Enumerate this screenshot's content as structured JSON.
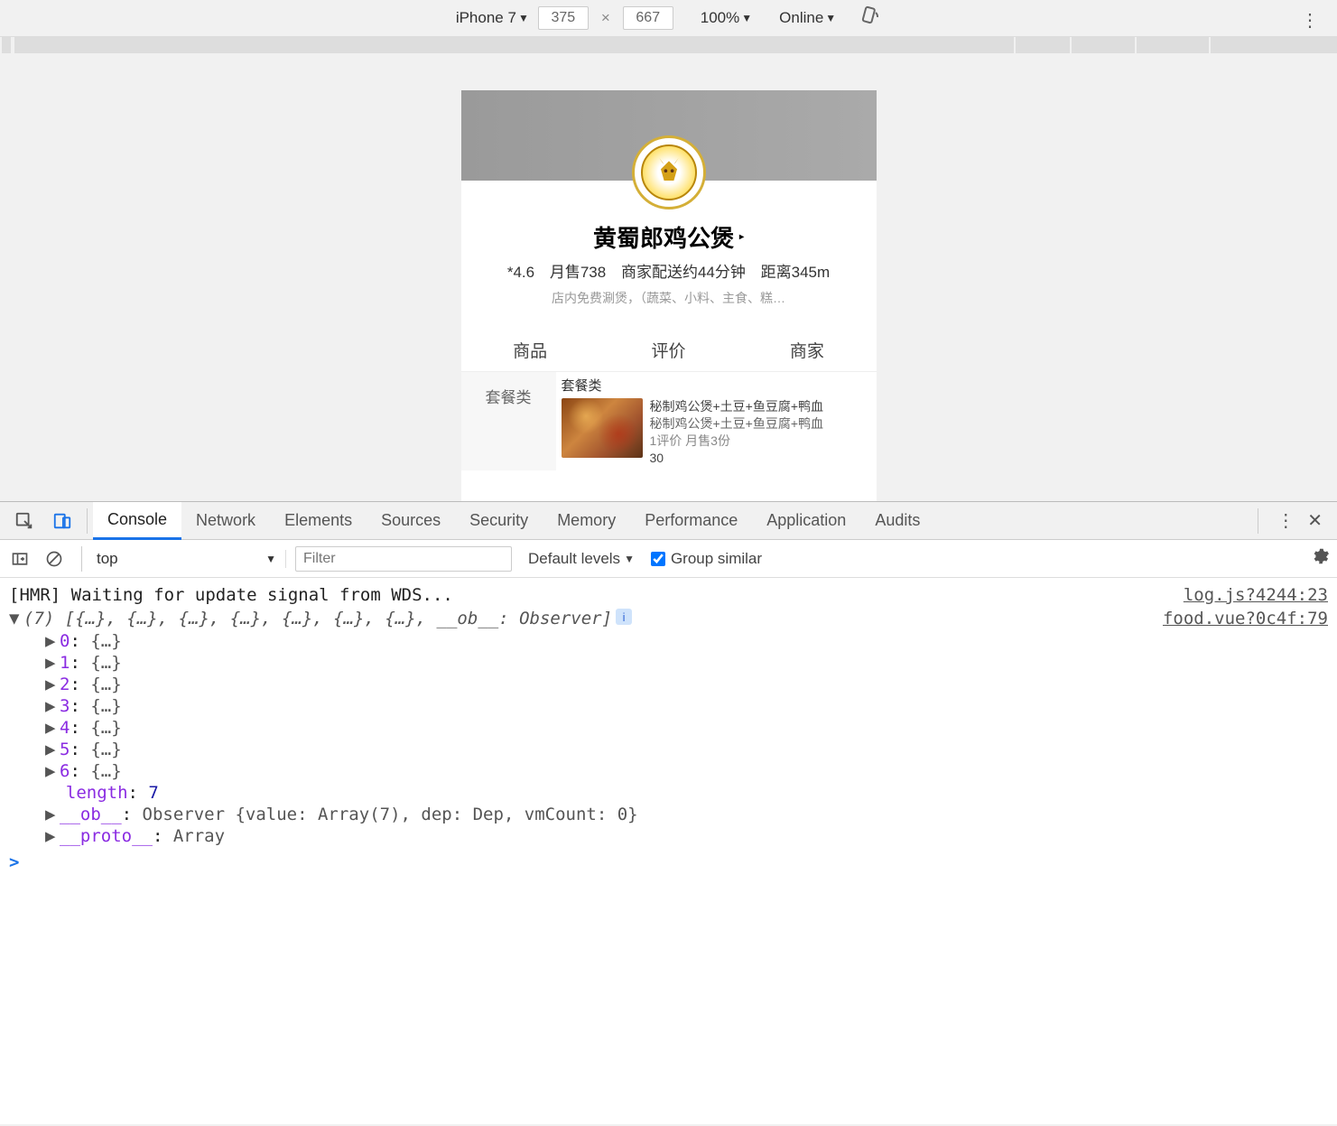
{
  "deviceToolbar": {
    "device": "iPhone 7",
    "width": "375",
    "height": "667",
    "zoom": "100%",
    "throttle": "Online"
  },
  "shop": {
    "title": "黄蜀郎鸡公煲",
    "rating": "*4.6",
    "monthlySales": "月售738",
    "delivery": "商家配送约44分钟",
    "distance": "距离345m",
    "desc": "店内免费涮煲，（蔬菜、小料、主食、糕…"
  },
  "tabs": {
    "goods": "商品",
    "reviews": "评价",
    "merchant": "商家"
  },
  "sidebar": {
    "cat0": "套餐类"
  },
  "section": {
    "title": "套餐类"
  },
  "food": {
    "name": "秘制鸡公煲+土豆+鱼豆腐+鸭血",
    "sub": "秘制鸡公煲+土豆+鱼豆腐+鸭血",
    "sales": "1评价 月售3份",
    "price": "30"
  },
  "devtools": {
    "tabs": {
      "console": "Console",
      "network": "Network",
      "elements": "Elements",
      "sources": "Sources",
      "security": "Security",
      "memory": "Memory",
      "performance": "Performance",
      "application": "Application",
      "audits": "Audits"
    },
    "context": "top",
    "filterPlaceholder": "Filter",
    "levels": "Default levels",
    "groupSimilar": "Group similar"
  },
  "console": {
    "hmr": "[HMR] Waiting for update signal from WDS...",
    "hmrSrc": "log.js?4244:23",
    "arrayHead": "(7) [{…}, {…}, {…}, {…}, {…}, {…}, {…}, __ob__: Observer]",
    "arraySrc": "food.vue?0c4f:79",
    "idx0": "0",
    "idx1": "1",
    "idx2": "2",
    "idx3": "3",
    "idx4": "4",
    "idx5": "5",
    "idx6": "6",
    "objStub": "{…}",
    "lengthKey": "length",
    "lengthVal": "7",
    "obKey": "__ob__",
    "obVal": "Observer {value: Array(7), dep: Dep, vmCount: 0}",
    "protoKey": "__proto__",
    "protoVal": "Array",
    "prompt": ">"
  }
}
